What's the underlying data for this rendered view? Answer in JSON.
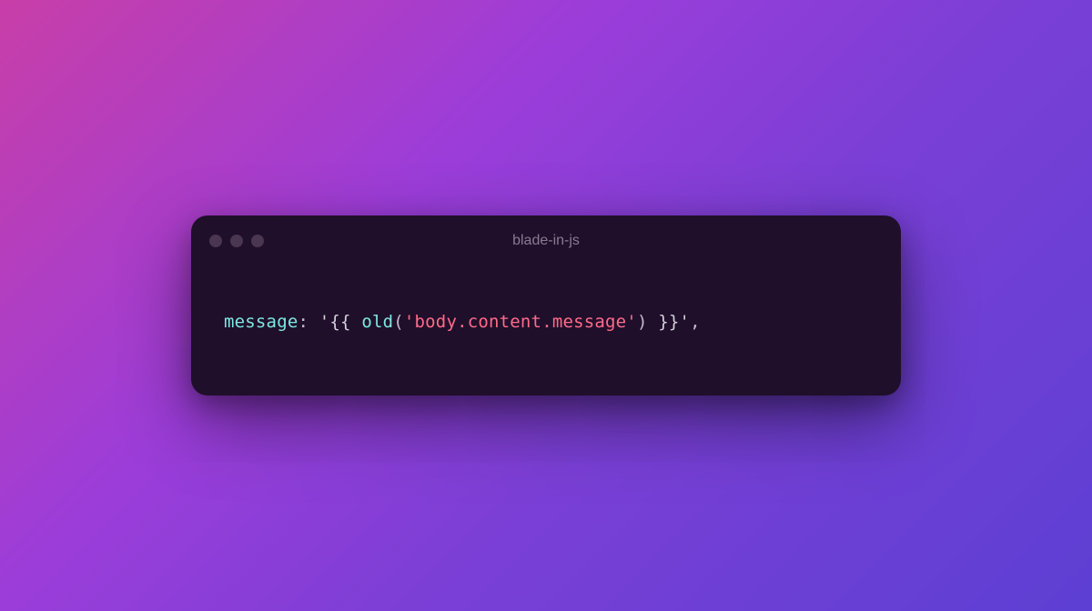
{
  "window": {
    "title": "blade-in-js"
  },
  "code": {
    "key": "message",
    "colon": ": ",
    "str_open": "'{{ ",
    "fn": "old",
    "paren_open": "(",
    "arg": "'body.content.message'",
    "paren_close": ")",
    "str_close": " }}'",
    "trailing": ","
  }
}
